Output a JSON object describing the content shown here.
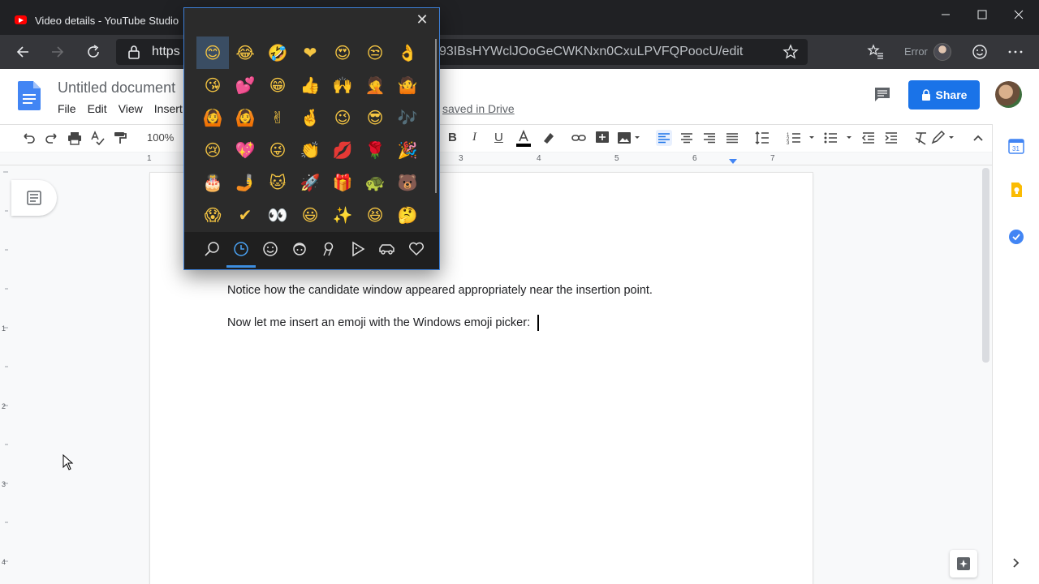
{
  "browser": {
    "tab_title": "Video details - YouTube Studio",
    "url_visible_start": "https",
    "url_visible_end": "93IBsHYWclJOoGeCWKNxn0CxuLPVFQPoocU/edit",
    "profile_status": "Error"
  },
  "docs": {
    "title": "Untitled document",
    "menu": [
      "File",
      "Edit",
      "View",
      "Insert"
    ],
    "saved_status": "saved in Drive",
    "share_label": "Share",
    "zoom": "100%",
    "ruler_numbers": [
      "1",
      "3",
      "4",
      "5",
      "6",
      "7"
    ],
    "left_ruler_numbers": [
      "1",
      "2",
      "3",
      "4"
    ]
  },
  "document": {
    "paragraphs": [
      "Notice how the candidate window appeared appropriately near the insertion point.",
      "Now let me insert an emoji with the Windows emoji picker:"
    ]
  },
  "emoji_picker": {
    "close_label": "✕",
    "selected_category": "recent",
    "emojis": [
      "😊",
      "😂",
      "🤣",
      "❤",
      "😍",
      "😒",
      "👌",
      "😘",
      "💕",
      "😁",
      "👍",
      "🙌",
      "🤦",
      "🤷",
      "🙆",
      "🙆",
      "✌",
      "🤞",
      "😉",
      "😎",
      "🎶",
      "😢",
      "💖",
      "😜",
      "👏",
      "💋",
      "🌹",
      "🎉",
      "🎂",
      "🤳",
      "🐱",
      "🚀",
      "🎁",
      "🐢",
      "🐻",
      "😱",
      "✔",
      "👀",
      "😃",
      "✨",
      "😆",
      "🤔"
    ],
    "categories": [
      "search-icon",
      "recent-icon",
      "smiley-icon",
      "people-icon",
      "celebration-icon",
      "food-icon",
      "transport-icon",
      "heart-icon"
    ]
  },
  "colors": {
    "accent": "#1a73e8",
    "picker_bg": "#2b2b2b",
    "picker_accent": "#3d8ee0"
  }
}
